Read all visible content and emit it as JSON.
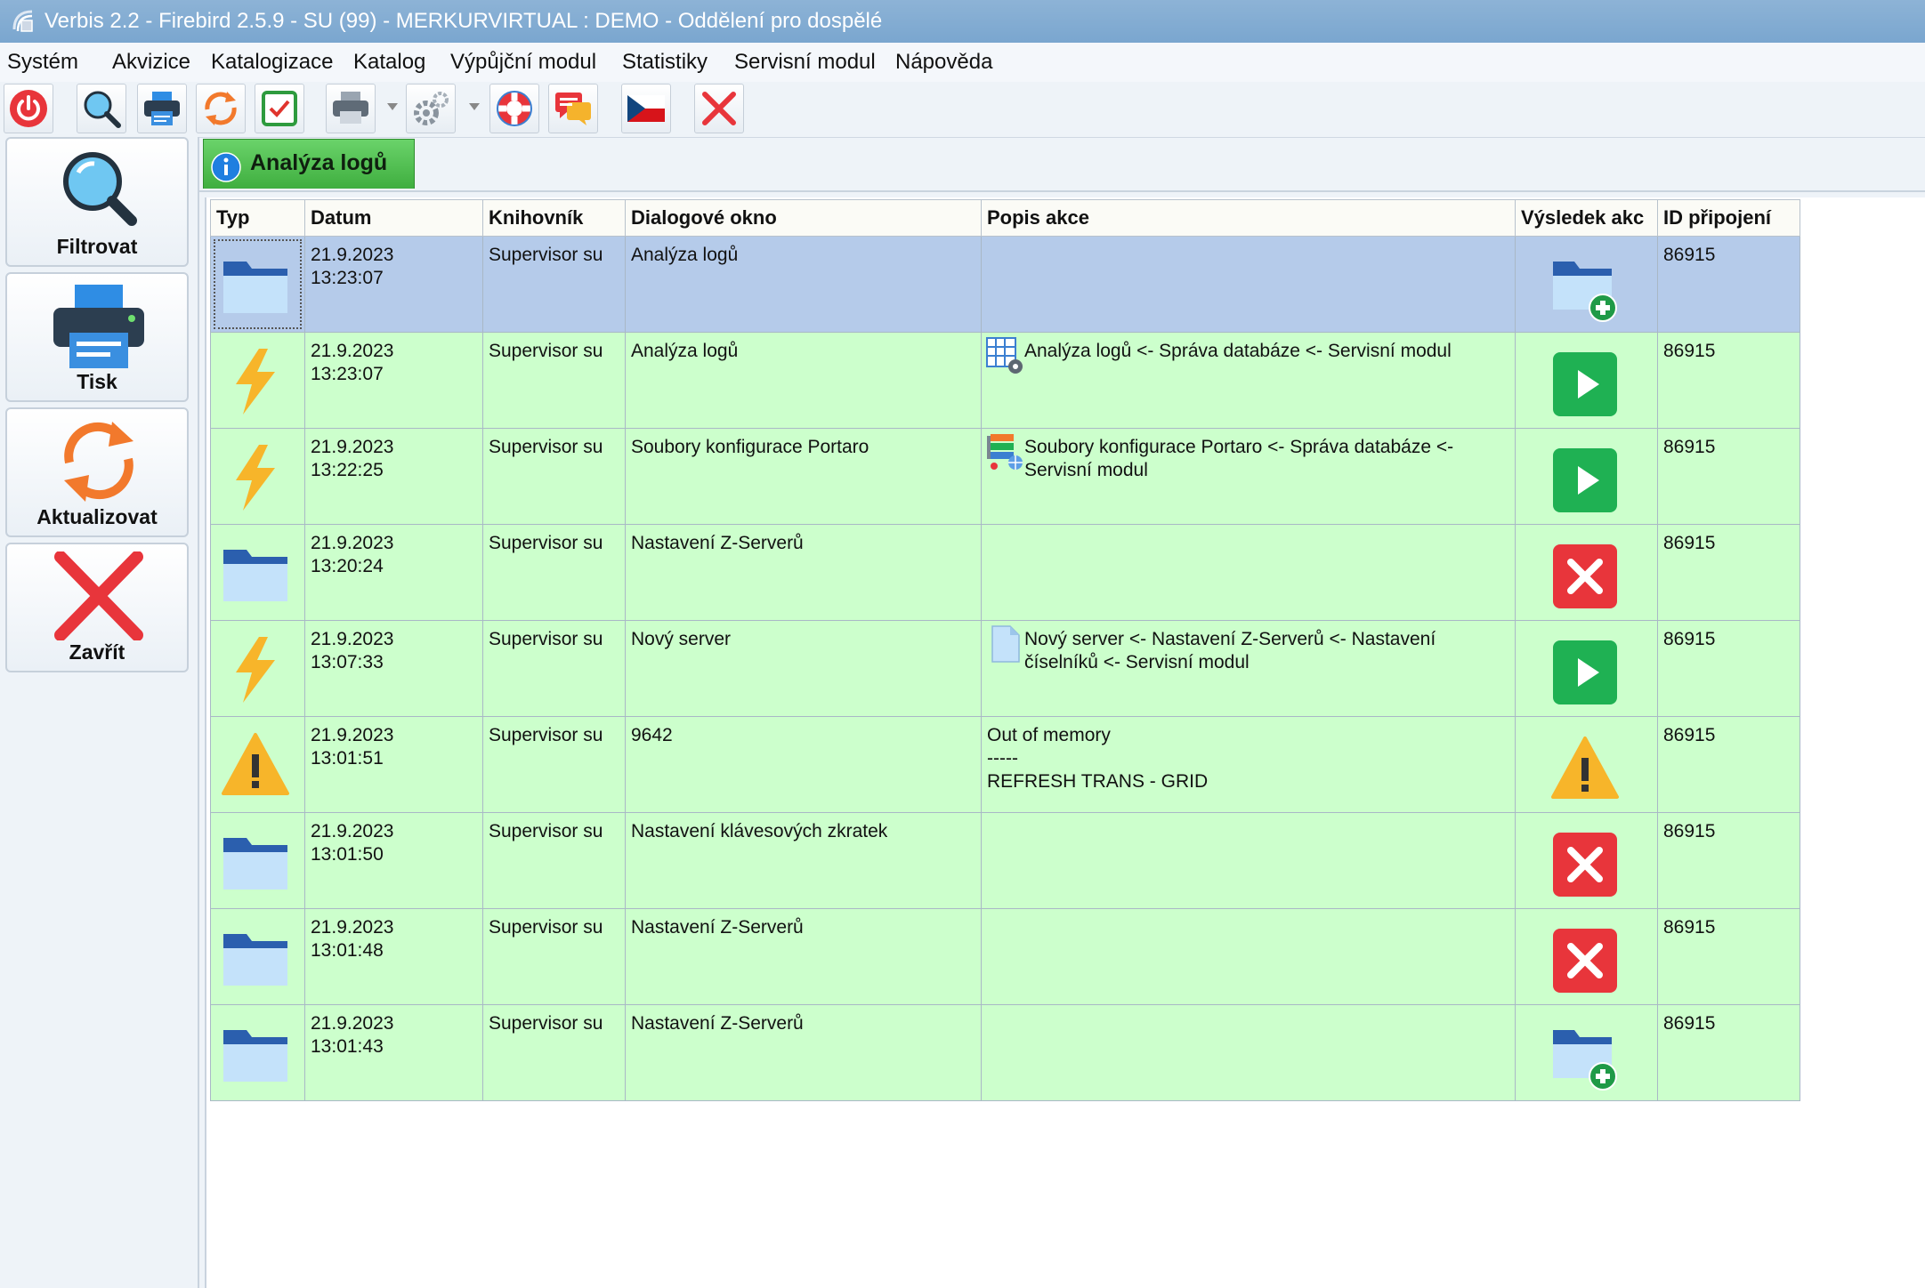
{
  "window": {
    "title": "Verbis 2.2 - Firebird 2.5.9 - SU (99) - MERKURVIRTUAL : DEMO - Oddělení pro dospělé"
  },
  "menu": [
    "Systém",
    "Akvizice",
    "Katalogizace",
    "Katalog",
    "Výpůjční modul",
    "Statistiky",
    "Servisní modul",
    "Nápověda"
  ],
  "toolbar": {
    "icons": [
      "power-icon",
      "search-icon",
      "printer-icon",
      "refresh-icon",
      "checkbox-icon",
      "print-setup-icon",
      "settings-icon",
      "help-lifebuoy-icon",
      "chat-icon",
      "czech-flag-icon",
      "close-icon"
    ]
  },
  "sidebar": {
    "filter_label": "Filtrovat",
    "print_label": "Tisk",
    "refresh_label": "Aktualizovat",
    "close_label": "Zavřít"
  },
  "tab": {
    "label": "Analýza logů"
  },
  "table": {
    "columns": [
      "Typ",
      "Datum",
      "Knihovník",
      "Dialogové okno",
      "Popis akce",
      "Výsledek akc",
      "ID připojení"
    ],
    "rows": [
      {
        "type": "folder",
        "datum": "21.9.2023\n13:23:07",
        "knihovnik": "Supervisor su",
        "okno": "Analýza logů",
        "popis_icon": "",
        "popis": "",
        "result": "folder-add",
        "id": "86915",
        "selected": true
      },
      {
        "type": "lightning",
        "datum": "21.9.2023\n13:23:07",
        "knihovnik": "Supervisor su",
        "okno": "Analýza logů",
        "popis_icon": "grid-settings-icon",
        "popis": "Analýza logů <- Správa databáze <- Servisní modul",
        "result": "play",
        "id": "86915"
      },
      {
        "type": "lightning",
        "datum": "21.9.2023\n13:22:25",
        "knihovnik": "Supervisor su",
        "okno": "Soubory konfigurace Portaro",
        "popis_icon": "config-files-icon",
        "popis": "Soubory konfigurace Portaro <- Správa databáze <- Servisní modul",
        "result": "play",
        "id": "86915"
      },
      {
        "type": "folder",
        "datum": "21.9.2023\n13:20:24",
        "knihovnik": "Supervisor su",
        "okno": "Nastavení Z-Serverů",
        "popis_icon": "",
        "popis": "",
        "result": "cross",
        "id": "86915"
      },
      {
        "type": "lightning",
        "datum": "21.9.2023\n13:07:33",
        "knihovnik": "Supervisor su",
        "okno": "Nový server",
        "popis_icon": "document-icon",
        "popis": "Nový server <- Nastavení Z-Serverů <- Nastavení číselníků <- Servisní modul",
        "result": "play",
        "id": "86915"
      },
      {
        "type": "warning",
        "datum": "21.9.2023\n13:01:51",
        "knihovnik": "Supervisor su",
        "okno": "9642",
        "popis_icon": "",
        "popis": "Out of memory\n-----\nREFRESH TRANS - GRID",
        "result": "warning",
        "id": "86915"
      },
      {
        "type": "folder",
        "datum": "21.9.2023\n13:01:50",
        "knihovnik": "Supervisor su",
        "okno": " Nastavení klávesových zkratek",
        "popis_icon": "",
        "popis": "",
        "result": "cross",
        "id": "86915"
      },
      {
        "type": "folder",
        "datum": "21.9.2023\n13:01:48",
        "knihovnik": "Supervisor su",
        "okno": "Nastavení Z-Serverů",
        "popis_icon": "",
        "popis": "",
        "result": "cross",
        "id": "86915"
      },
      {
        "type": "folder",
        "datum": "21.9.2023\n13:01:43",
        "knihovnik": "Supervisor su",
        "okno": "Nastavení Z-Serverů",
        "popis_icon": "",
        "popis": "",
        "result": "folder-add",
        "id": "86915"
      }
    ]
  },
  "colors": {
    "row_bg": "#ccffcc",
    "selected_bg": "#b5cbea",
    "tab_green": "#4cbf4c",
    "accent_red": "#e8353b",
    "play_green": "#1fb153"
  }
}
